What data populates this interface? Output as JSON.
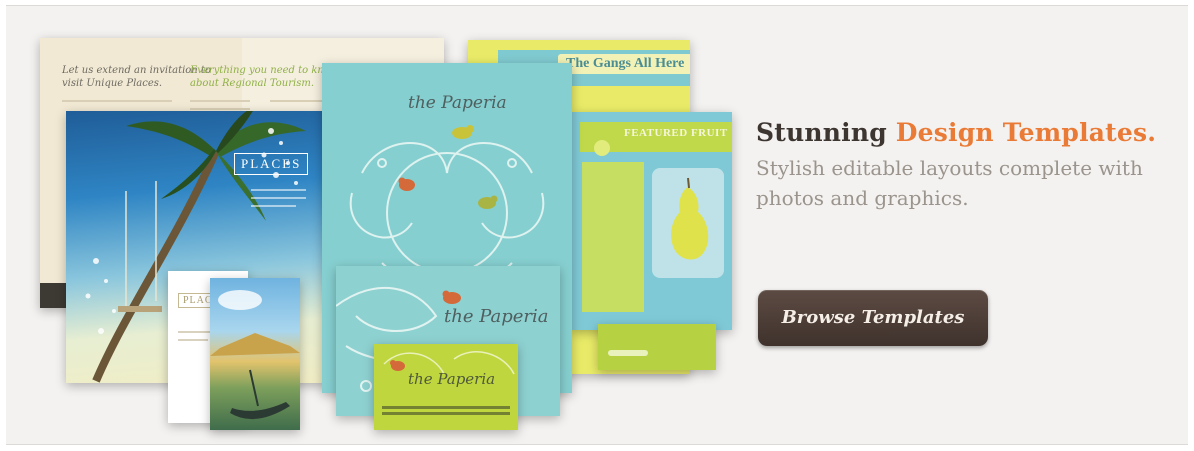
{
  "banner": {
    "headline_dark": "Stunning",
    "headline_accent": "Design Templates.",
    "subline": "Stylish editable layouts complete with photos and graphics.",
    "button_label": "Browse Templates",
    "colors": {
      "background": "#f4f2f0",
      "headline": "#3c3530",
      "accent": "#ea7b36",
      "subline": "#9a948d",
      "button": "#4a3c35",
      "aqua": "#7cc8cc",
      "lime": "#b6d243",
      "yellow": "#e7ea5b"
    }
  },
  "templates": {
    "brochure_left": "Let us extend an invitation to visit Unique Places.",
    "brochure_right": "Everything you need to know about Regional Tourism.",
    "places_label": "PLACES",
    "places_card_label": "PLACE",
    "gangs_title": "The Gangs All Here",
    "featured_title": "FEATURED FRUIT",
    "paperie_name": "the Paperia",
    "paperie_card_name": "the Paperia"
  }
}
